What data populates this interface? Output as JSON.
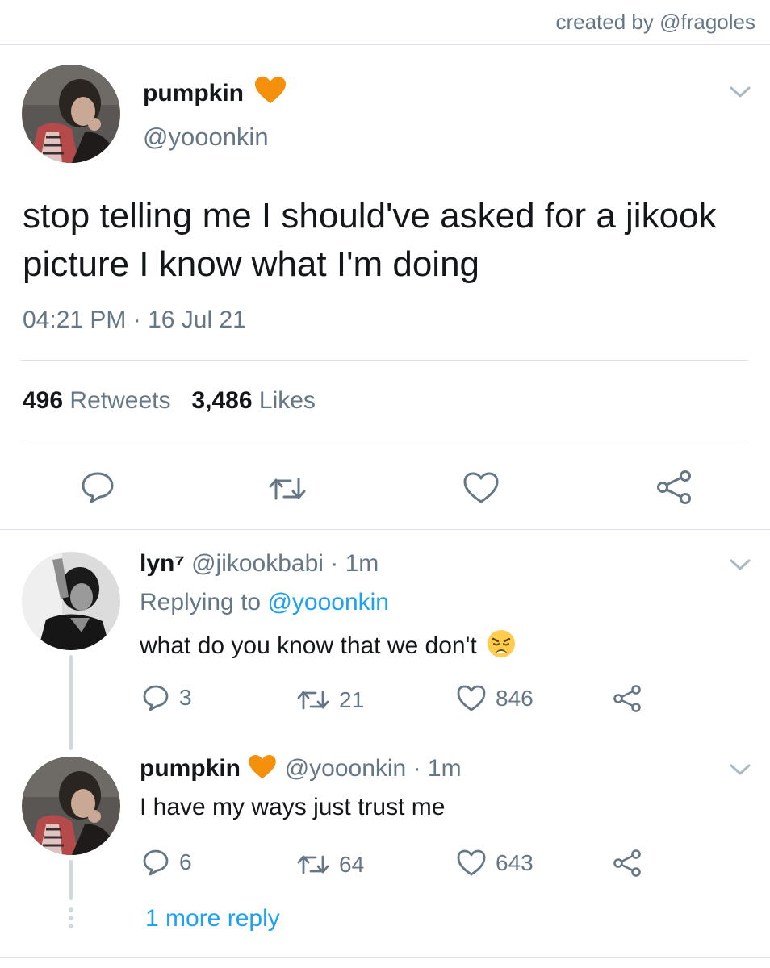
{
  "credit": "created by @fragoles",
  "main_tweet": {
    "name": "pumpkin",
    "handle": "@yooonkin",
    "text": "stop telling me I should've asked for a jikook picture I know what I'm doing",
    "timestamp": "04:21 PM · 16 Jul 21",
    "retweets_count": "496",
    "retweets_label": "Retweets",
    "likes_count": "3,486",
    "likes_label": "Likes"
  },
  "replies": [
    {
      "name": "lyn⁷",
      "handle": "@jikookbabi",
      "time": "· 1m",
      "replying_prefix": "Replying to",
      "replying_to": "@yooonkin",
      "text": "what do you know that we don't",
      "emoji": "😩",
      "replies": "3",
      "retweets": "21",
      "likes": "846"
    },
    {
      "name": "pumpkin",
      "handle": "@yooonkin",
      "time": "· 1m",
      "text": "I have my ways just trust me",
      "replies": "6",
      "retweets": "64",
      "likes": "643"
    }
  ],
  "more_replies": "1 more reply",
  "colors": {
    "accent": "#1da1f2",
    "secondary_text": "#657786",
    "heart_badge": "#f5900c"
  },
  "icons": [
    "chevron-down-icon",
    "reply-icon",
    "retweet-icon",
    "like-icon",
    "share-icon",
    "orange-heart-icon",
    "weary-face-emoji"
  ]
}
